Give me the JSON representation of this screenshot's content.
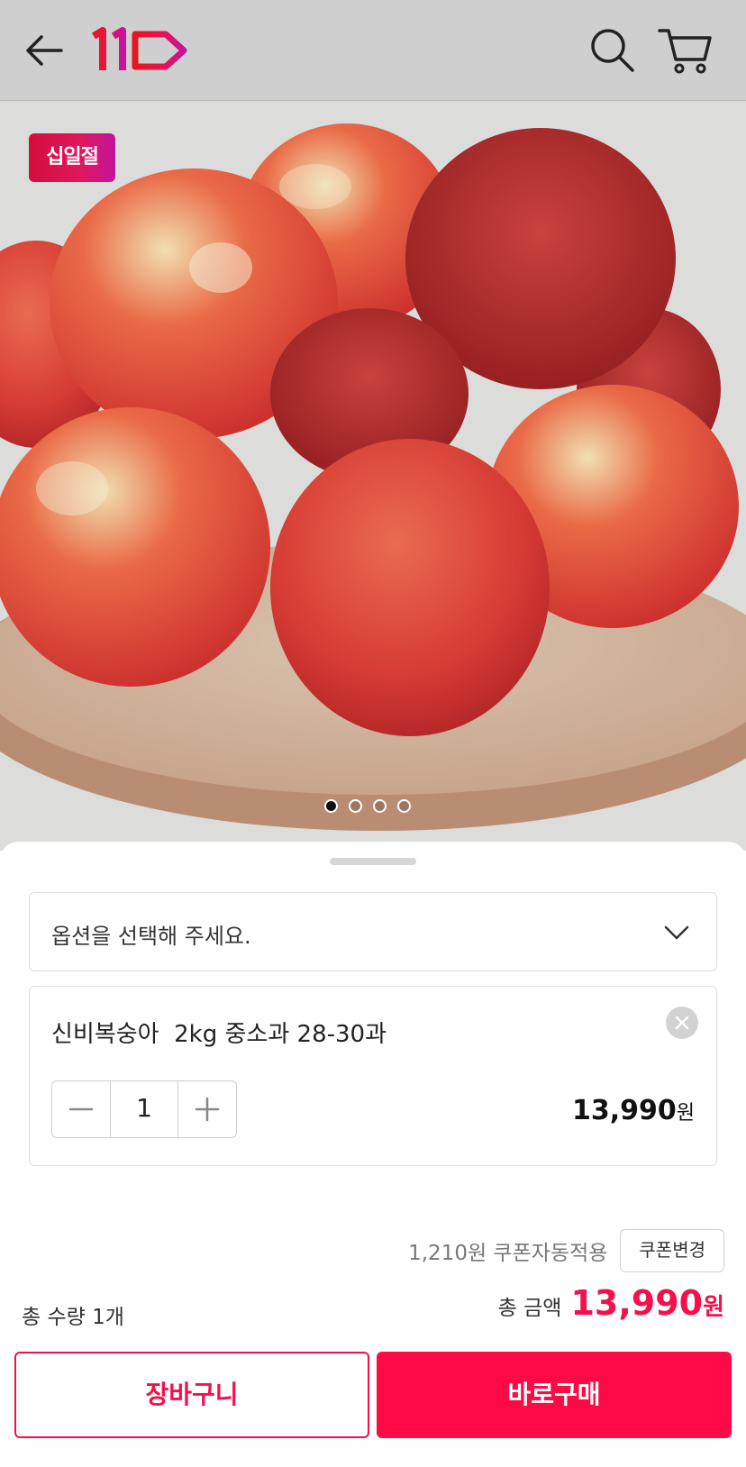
{
  "header": {
    "logo_text": "11",
    "icons": [
      "back-arrow-icon",
      "search-icon",
      "cart-icon"
    ]
  },
  "hero": {
    "badge": "십일절",
    "carousel": {
      "total": 4,
      "current": 1
    }
  },
  "option_select": {
    "placeholder": "옵션을 선택해 주세요."
  },
  "selected_item": {
    "name": "신비복숭아  2kg 중소과 28-30과",
    "quantity": "1",
    "price": "13,990",
    "price_unit": "원"
  },
  "coupon": {
    "text": "1,210원 쿠폰자동적용",
    "button": "쿠폰변경"
  },
  "summary": {
    "total_qty": "총 수량 1개",
    "total_label": "총 금액",
    "total_value": "13,990",
    "total_unit": "원"
  },
  "actions": {
    "cart": "장바구니",
    "buy": "바로구매"
  },
  "colors": {
    "accent": "#f4104d",
    "buy_button": "#ff0a47"
  }
}
